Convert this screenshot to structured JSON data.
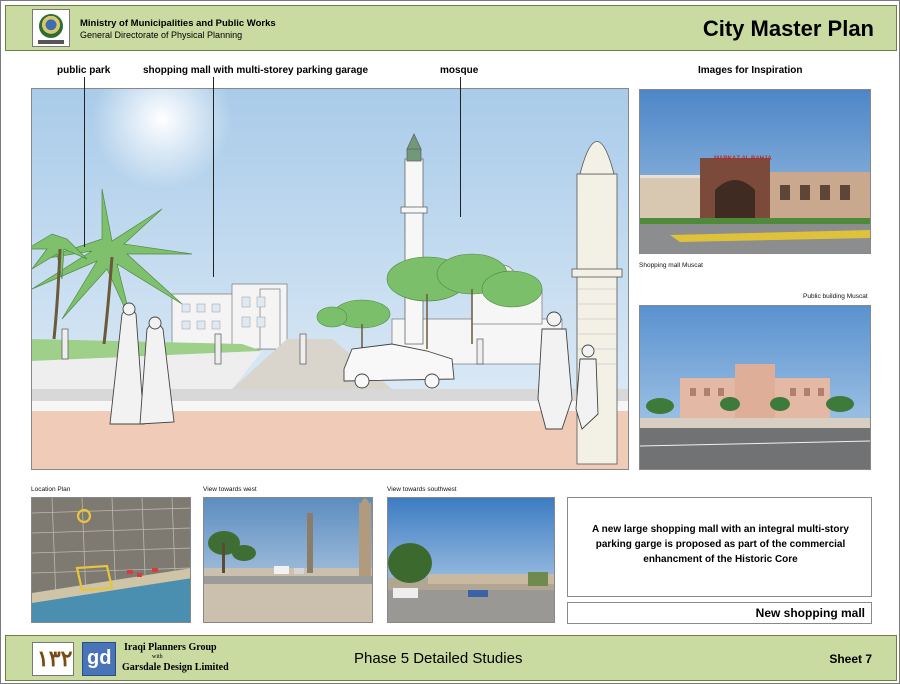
{
  "header": {
    "org_line1": "Ministry of Municipalities and Public Works",
    "org_line2": "General Directorate of Physical Planning",
    "title": "City Master Plan"
  },
  "callouts": {
    "park": "public park",
    "mall": "shopping mall with multi-storey parking garage",
    "mosque": "mosque",
    "inspiration": "Images for Inspiration"
  },
  "captions": {
    "mall_muscat": "Shopping mall Muscat",
    "public_building": "Public building Muscat",
    "location_plan": "Location Plan",
    "view_west": "View towards west",
    "view_southwest": "View towards southwest"
  },
  "signage": {
    "markaz": "MARKAZ AL BAHJA"
  },
  "description": {
    "text": "A new large shopping mall with an integral multi-story parking garge is proposed as part of the commercial enhancment of the Historic Core",
    "name": "New shopping mall"
  },
  "footer": {
    "group_line1": "Iraqi Planners Group",
    "group_with": "with",
    "group_line2": "Garsdale Design Limited",
    "phase": "Phase 5 Detailed Studies",
    "sheet": "Sheet 7"
  },
  "colors": {
    "band": "#c9dba0",
    "band_border": "#6d7f44",
    "sky": "#bcd8ee",
    "pavement": "#f0cbb8"
  }
}
